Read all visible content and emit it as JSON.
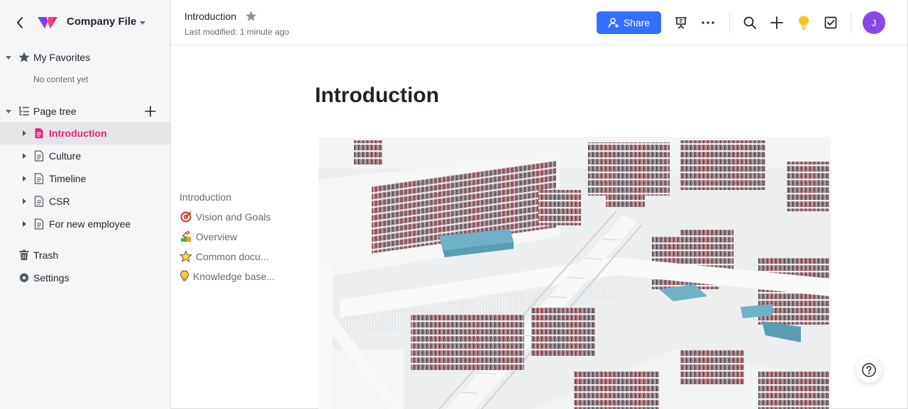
{
  "sidebar": {
    "company_title": "Company File",
    "favorites": {
      "label": "My Favorites",
      "empty_text": "No content yet"
    },
    "page_tree": {
      "label": "Page tree",
      "items": [
        {
          "label": "Introduction"
        },
        {
          "label": "Culture"
        },
        {
          "label": "Timeline"
        },
        {
          "label": "CSR"
        },
        {
          "label": "For new employee"
        }
      ]
    },
    "trash_label": "Trash",
    "settings_label": "Settings"
  },
  "topbar": {
    "doc_title": "Introduction",
    "last_modified": "Last modified: 1 minute ago",
    "share_label": "Share",
    "avatar_initial": "J"
  },
  "outline": {
    "items": [
      {
        "label": "Introduction",
        "icon": ""
      },
      {
        "label": "Vision and Goals",
        "icon": "target-icon"
      },
      {
        "label": "Overview",
        "icon": "growth-icon"
      },
      {
        "label": "Common docu...",
        "icon": "star-icon"
      },
      {
        "label": "Knowledge base...",
        "icon": "bulb-icon"
      }
    ]
  },
  "main": {
    "heading": "Introduction",
    "image_name": "library-interior-image"
  },
  "colors": {
    "accent": "#3370ff",
    "active_page": "#e5267e",
    "avatar": "#8b47e8"
  }
}
